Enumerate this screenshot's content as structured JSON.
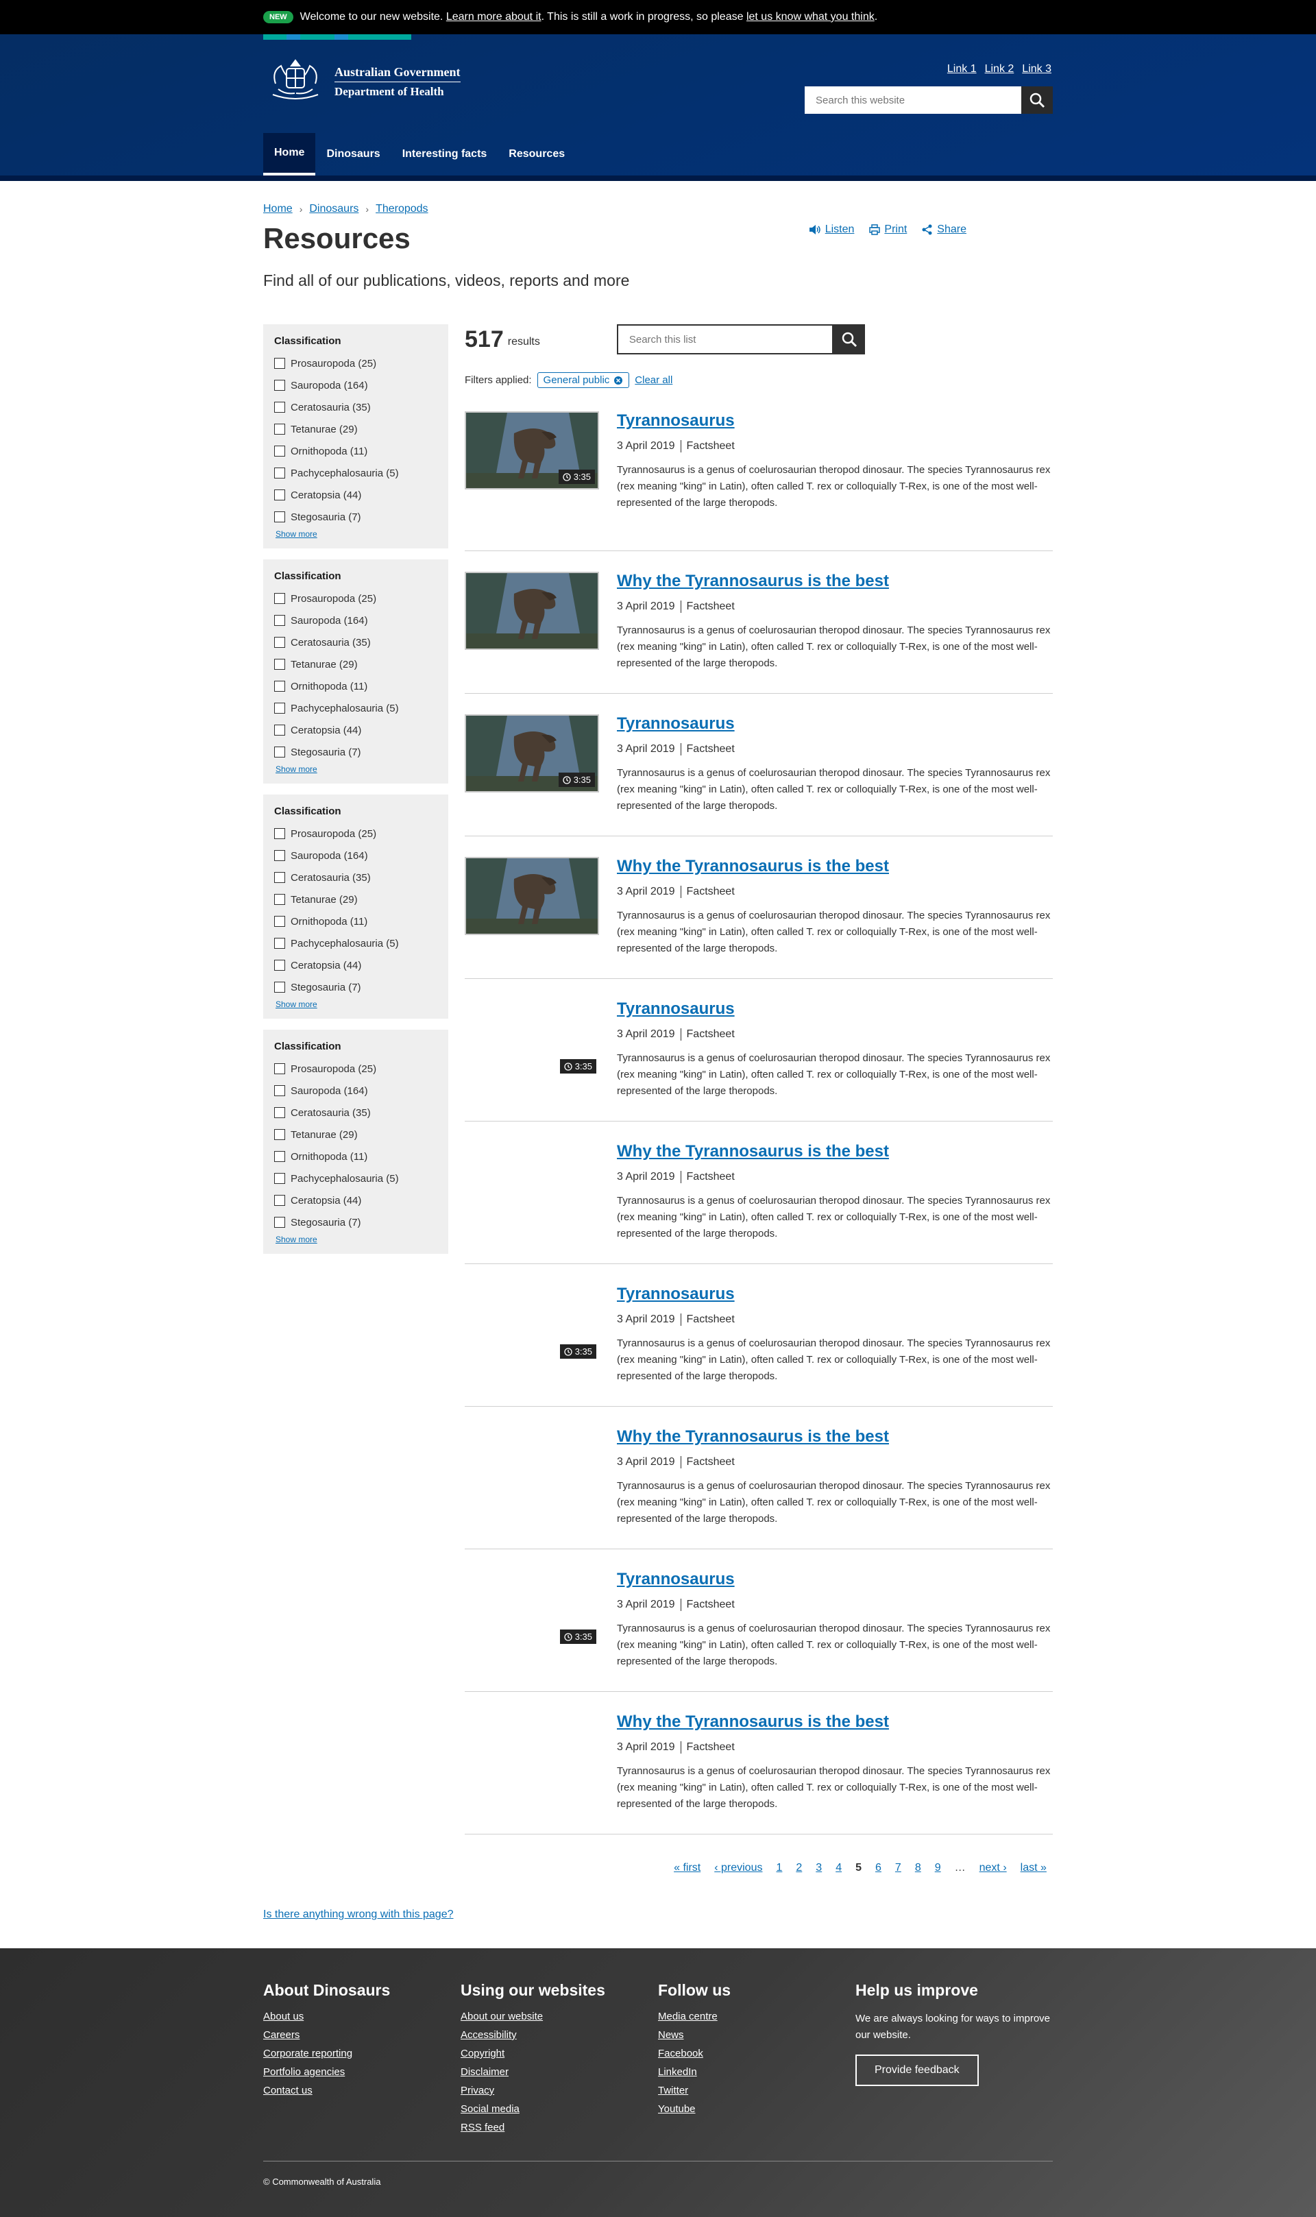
{
  "notice": {
    "badge": "NEW",
    "text1": "Welcome to our new website.",
    "link1": "Learn more about it",
    "text2": ". This is still a work in progress, so please",
    "link2": "let us know what you think",
    "text3": "."
  },
  "header": {
    "logo_line1": "Australian Government",
    "logo_line2": "Department of Health",
    "top_links": [
      "Link 1",
      "Link 2",
      "Link 3"
    ],
    "search_placeholder": "Search this website",
    "nav": [
      "Home",
      "Dinosaurs",
      "Interesting facts",
      "Resources"
    ],
    "strip_colors": [
      "#00a99d",
      "#1c8ecf",
      "#00a99d",
      "#1c8ecf",
      "#00a99d"
    ]
  },
  "breadcrumbs": [
    "Home",
    "Dinosaurs",
    "Theropods"
  ],
  "tools": [
    "Listen",
    "Print",
    "Share"
  ],
  "page": {
    "title": "Resources",
    "intro": "Find all of our publications, videos, reports and more"
  },
  "facets": [
    {
      "title": "Classification",
      "show_more": "Show more",
      "options": [
        "Prosauropoda (25)",
        "Sauropoda (164)",
        "Ceratosauria (35)",
        "Tetanurae (29)",
        "Ornithopoda (11)",
        "Pachycephalosauria (5)",
        "Ceratopsia (44)",
        "Stegosauria (7)"
      ]
    },
    {
      "title": "Classification",
      "show_more": "Show more",
      "options": [
        "Prosauropoda (25)",
        "Sauropoda (164)",
        "Ceratosauria (35)",
        "Tetanurae (29)",
        "Ornithopoda (11)",
        "Pachycephalosauria (5)",
        "Ceratopsia (44)",
        "Stegosauria (7)"
      ]
    },
    {
      "title": "Classification",
      "show_more": "Show more",
      "options": [
        "Prosauropoda (25)",
        "Sauropoda (164)",
        "Ceratosauria (35)",
        "Tetanurae (29)",
        "Ornithopoda (11)",
        "Pachycephalosauria (5)",
        "Ceratopsia (44)",
        "Stegosauria (7)"
      ]
    },
    {
      "title": "Classification",
      "show_more": "Show more",
      "options": [
        "Prosauropoda (25)",
        "Sauropoda (164)",
        "Ceratosauria (35)",
        "Tetanurae (29)",
        "Ornithopoda (11)",
        "Pachycephalosauria (5)",
        "Ceratopsia (44)",
        "Stegosauria (7)"
      ]
    }
  ],
  "results_header": {
    "count": "517",
    "count_label": "results",
    "search_placeholder": "Search this list",
    "filters_label": "Filters applied:",
    "chip": "General public",
    "clear": "Clear all"
  },
  "results": [
    {
      "title": "Tyrannosaurus",
      "date": "3 April 2019",
      "type": "Factsheet",
      "image": true,
      "duration": "3:35",
      "desc": "Tyrannosaurus is a genus of coelurosaurian theropod dinosaur. The species Tyrannosaurus rex (rex meaning \"king\" in Latin), often called T. rex or colloquially T-Rex, is one of the most well-represented of the large theropods."
    },
    {
      "title": "Why the Tyrannosaurus is the best",
      "date": "3 April 2019",
      "type": "Factsheet",
      "image": true,
      "duration": "",
      "desc": "Tyrannosaurus is a genus of coelurosaurian theropod dinosaur. The species Tyrannosaurus rex (rex meaning \"king\" in Latin), often called T. rex or colloquially T-Rex, is one of the most well-represented of the large theropods."
    },
    {
      "title": "Tyrannosaurus",
      "date": "3 April 2019",
      "type": "Factsheet",
      "image": true,
      "duration": "3:35",
      "desc": "Tyrannosaurus is a genus of coelurosaurian theropod dinosaur. The species Tyrannosaurus rex (rex meaning \"king\" in Latin), often called T. rex or colloquially T-Rex, is one of the most well-represented of the large theropods."
    },
    {
      "title": "Why the Tyrannosaurus is the best",
      "date": "3 April 2019",
      "type": "Factsheet",
      "image": true,
      "duration": "",
      "desc": "Tyrannosaurus is a genus of coelurosaurian theropod dinosaur. The species Tyrannosaurus rex (rex meaning \"king\" in Latin), often called T. rex or colloquially T-Rex, is one of the most well-represented of the large theropods."
    },
    {
      "title": "Tyrannosaurus",
      "date": "3 April 2019",
      "type": "Factsheet",
      "image": false,
      "duration": "3:35",
      "desc": "Tyrannosaurus is a genus of coelurosaurian theropod dinosaur. The species Tyrannosaurus rex (rex meaning \"king\" in Latin), often called T. rex or colloquially T-Rex, is one of the most well-represented of the large theropods."
    },
    {
      "title": "Why the Tyrannosaurus is the best",
      "date": "3 April 2019",
      "type": "Factsheet",
      "image": false,
      "duration": "",
      "desc": "Tyrannosaurus is a genus of coelurosaurian theropod dinosaur. The species Tyrannosaurus rex (rex meaning \"king\" in Latin), often called T. rex or colloquially T-Rex, is one of the most well-represented of the large theropods."
    },
    {
      "title": "Tyrannosaurus",
      "date": "3 April 2019",
      "type": "Factsheet",
      "image": false,
      "duration": "3:35",
      "desc": "Tyrannosaurus is a genus of coelurosaurian theropod dinosaur. The species Tyrannosaurus rex (rex meaning \"king\" in Latin), often called T. rex or colloquially T-Rex, is one of the most well-represented of the large theropods."
    },
    {
      "title": "Why the Tyrannosaurus is the best",
      "date": "3 April 2019",
      "type": "Factsheet",
      "image": false,
      "duration": "",
      "desc": "Tyrannosaurus is a genus of coelurosaurian theropod dinosaur. The species Tyrannosaurus rex (rex meaning \"king\" in Latin), often called T. rex or colloquially T-Rex, is one of the most well-represented of the large theropods."
    },
    {
      "title": "Tyrannosaurus",
      "date": "3 April 2019",
      "type": "Factsheet",
      "image": false,
      "duration": "3:35",
      "desc": "Tyrannosaurus is a genus of coelurosaurian theropod dinosaur. The species Tyrannosaurus rex (rex meaning \"king\" in Latin), often called T. rex or colloquially T-Rex, is one of the most well-represented of the large theropods."
    },
    {
      "title": "Why the Tyrannosaurus is the best",
      "date": "3 April 2019",
      "type": "Factsheet",
      "image": false,
      "duration": "",
      "desc": "Tyrannosaurus is a genus of coelurosaurian theropod dinosaur. The species Tyrannosaurus rex (rex meaning \"king\" in Latin), often called T. rex or colloquially T-Rex, is one of the most well-represented of the large theropods."
    }
  ],
  "pagination": {
    "first": "« first",
    "previous": "‹ previous",
    "pages": [
      "1",
      "2",
      "3",
      "4",
      "5",
      "6",
      "7",
      "8",
      "9"
    ],
    "current": "5",
    "ellipsis": "…",
    "next": "next ›",
    "last": "last »"
  },
  "feedback_link": "Is there anything wrong with this page?",
  "footer": {
    "cols": [
      {
        "title": "About Dinosaurs",
        "links": [
          "About us",
          "Careers",
          "Corporate reporting",
          "Portfolio agencies",
          "Contact us"
        ]
      },
      {
        "title": "Using our websites",
        "links": [
          "About our website",
          "Accessibility",
          "Copyright",
          "Disclaimer",
          "Privacy",
          "Social media",
          "RSS feed"
        ]
      },
      {
        "title": "Follow us",
        "links": [
          "Media centre",
          "News",
          "Facebook",
          "LinkedIn",
          "Twitter",
          "Youtube"
        ]
      }
    ],
    "improve_title": "Help us improve",
    "improve_text": "We are always looking for ways to improve our website.",
    "improve_button": "Provide feedback",
    "copyright": "© Commonwealth of Australia"
  }
}
